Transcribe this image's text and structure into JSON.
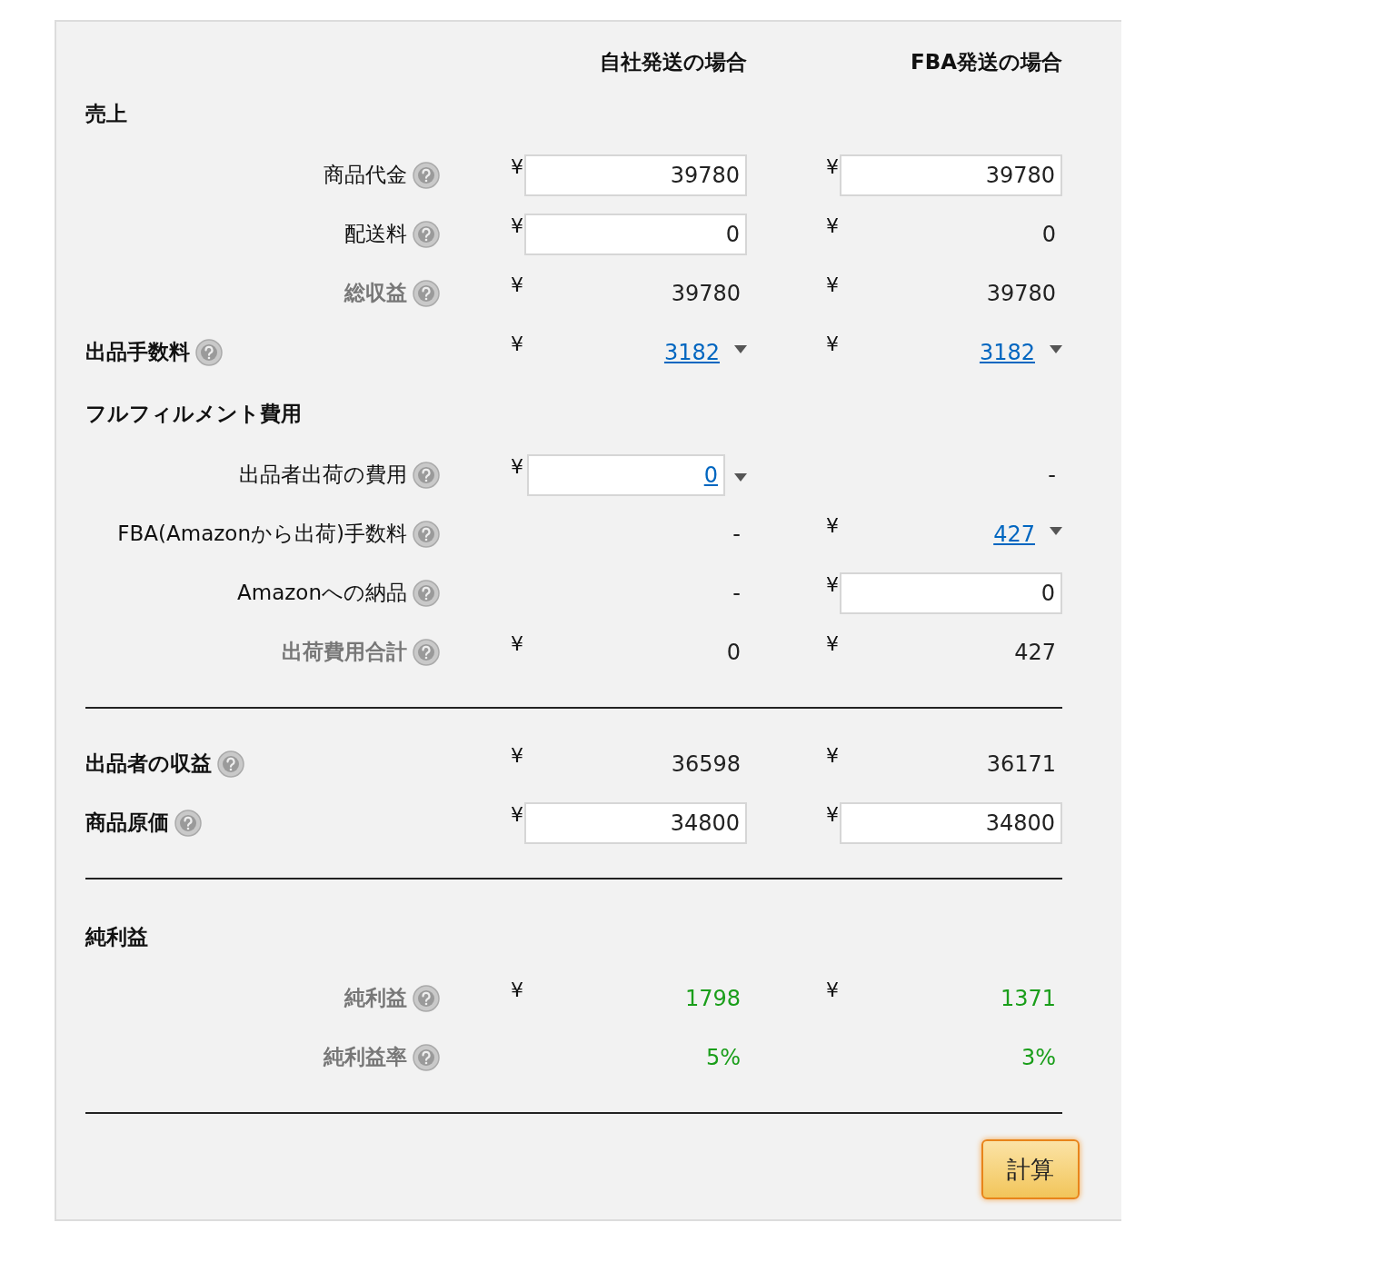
{
  "columns": [
    "自社発送の場合",
    "FBA発送の場合"
  ],
  "rows": [
    {
      "kind": "heading",
      "label": "売上"
    },
    {
      "kind": "item",
      "label": "商品代金",
      "cells": [
        {
          "kind": "input",
          "currency": "¥",
          "value": "39780"
        },
        {
          "kind": "input",
          "currency": "¥",
          "value": "39780"
        }
      ]
    },
    {
      "kind": "item",
      "label": "配送料",
      "cells": [
        {
          "kind": "input",
          "currency": "¥",
          "value": "0"
        },
        {
          "kind": "text",
          "currency": "¥",
          "value": "0"
        }
      ]
    },
    {
      "kind": "total",
      "label": "総収益",
      "cells": [
        {
          "kind": "text",
          "currency": "¥",
          "value": "39780"
        },
        {
          "kind": "text",
          "currency": "¥",
          "value": "39780"
        }
      ]
    },
    {
      "kind": "main",
      "label": "出品手数料",
      "cells": [
        {
          "kind": "link",
          "currency": "¥",
          "value": "3182"
        },
        {
          "kind": "link",
          "currency": "¥",
          "value": "3182"
        }
      ]
    },
    {
      "kind": "heading",
      "label": "フルフィルメント費用"
    },
    {
      "kind": "item",
      "label": "出品者出荷の費用",
      "cells": [
        {
          "kind": "link-input",
          "currency": "¥",
          "value": "0"
        },
        {
          "kind": "dash",
          "value": "-"
        }
      ]
    },
    {
      "kind": "item",
      "label": "FBA(Amazonから出荷)手数料",
      "cells": [
        {
          "kind": "dash",
          "value": "-"
        },
        {
          "kind": "link",
          "currency": "¥",
          "value": "427"
        }
      ]
    },
    {
      "kind": "item",
      "label": "Amazonへの納品",
      "cells": [
        {
          "kind": "dash",
          "value": "-"
        },
        {
          "kind": "input",
          "currency": "¥",
          "value": "0"
        }
      ]
    },
    {
      "kind": "total",
      "label": "出荷費用合計",
      "cells": [
        {
          "kind": "text",
          "currency": "¥",
          "value": "0"
        },
        {
          "kind": "text",
          "currency": "¥",
          "value": "427"
        }
      ]
    },
    {
      "kind": "divider"
    },
    {
      "kind": "main",
      "label": "出品者の収益",
      "cells": [
        {
          "kind": "text",
          "currency": "¥",
          "value": "36598"
        },
        {
          "kind": "text",
          "currency": "¥",
          "value": "36171"
        }
      ]
    },
    {
      "kind": "main",
      "label": "商品原価",
      "cells": [
        {
          "kind": "input",
          "currency": "¥",
          "value": "34800"
        },
        {
          "kind": "input",
          "currency": "¥",
          "value": "34800"
        }
      ]
    },
    {
      "kind": "divider"
    },
    {
      "kind": "heading",
      "label": "純利益"
    },
    {
      "kind": "total",
      "label": "純利益",
      "cells": [
        {
          "kind": "text",
          "currency": "¥",
          "value": "1798",
          "color": "#1a9e1a"
        },
        {
          "kind": "text",
          "currency": "¥",
          "value": "1371",
          "color": "#1a9e1a"
        }
      ]
    },
    {
      "kind": "total",
      "label": "純利益率",
      "cells": [
        {
          "kind": "text",
          "value": "5%",
          "color": "#1a9e1a"
        },
        {
          "kind": "text",
          "value": "3%",
          "color": "#1a9e1a"
        }
      ]
    },
    {
      "kind": "divider"
    }
  ],
  "button": {
    "label": "計算"
  }
}
